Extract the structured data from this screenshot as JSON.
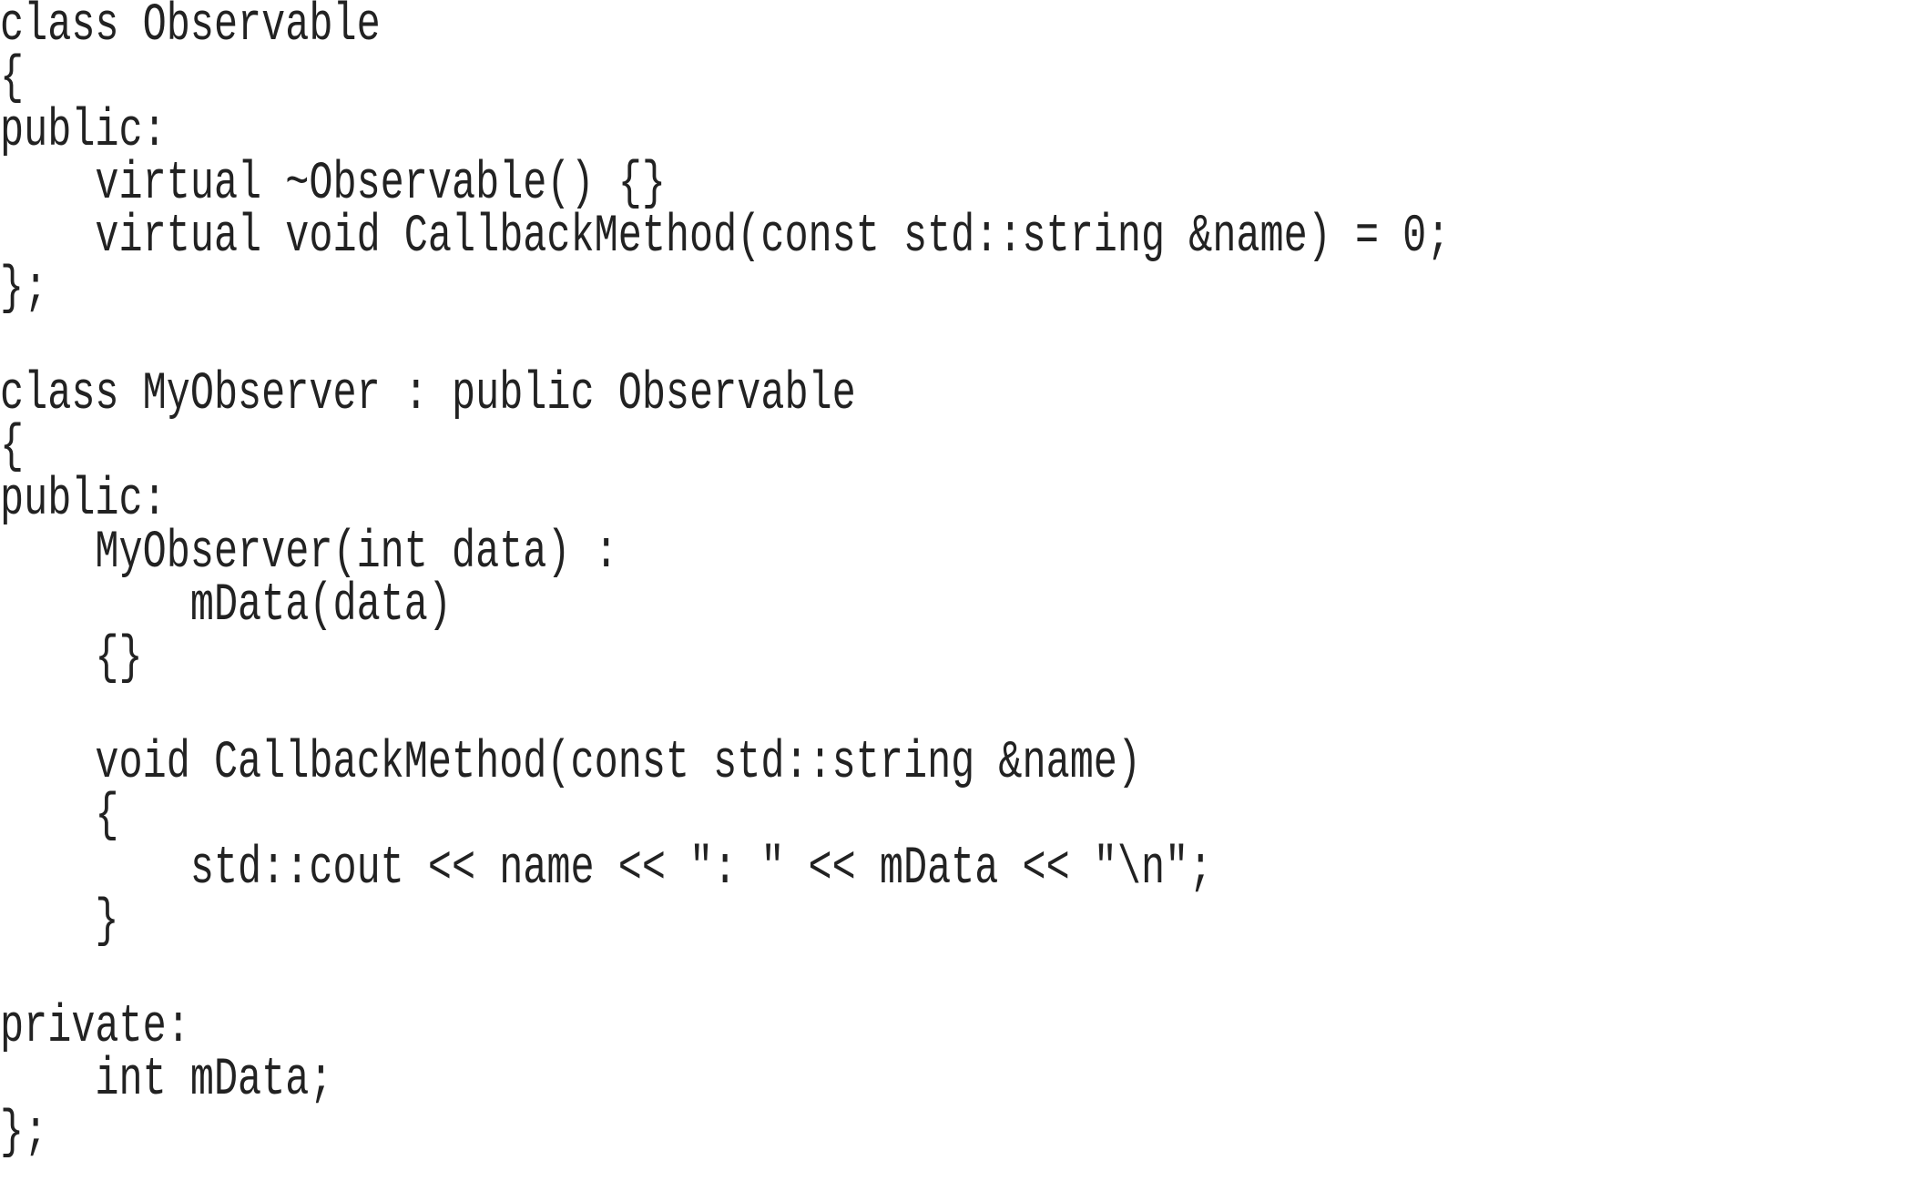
{
  "code": {
    "language": "C++",
    "lines": [
      "class Observable",
      "{",
      "public:",
      "    virtual ~Observable() {}",
      "    virtual void CallbackMethod(const std::string &name) = 0;",
      "};",
      "",
      "class MyObserver : public Observable",
      "{",
      "public:",
      "    MyObserver(int data) :",
      "        mData(data)",
      "    {}",
      "",
      "    void CallbackMethod(const std::string &name)",
      "    {",
      "        std::cout << name << \": \" << mData << \"\\n\";",
      "    }",
      "",
      "private:",
      "    int mData;",
      "};"
    ]
  }
}
